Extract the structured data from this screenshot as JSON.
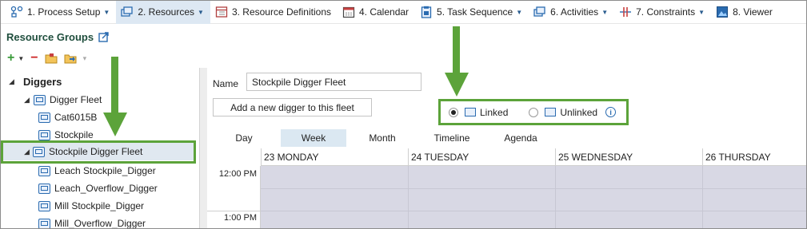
{
  "menu": [
    {
      "label": "1. Process Setup",
      "icon": "process-setup-icon",
      "caret": true
    },
    {
      "label": "2. Resources",
      "icon": "resources-icon",
      "caret": true,
      "active": true
    },
    {
      "label": "3. Resource Definitions",
      "icon": "resource-definitions-icon",
      "caret": false
    },
    {
      "label": "4. Calendar",
      "icon": "calendar-icon",
      "caret": false
    },
    {
      "label": "5. Task Sequence",
      "icon": "task-sequence-icon",
      "caret": true
    },
    {
      "label": "6. Activities",
      "icon": "activities-icon",
      "caret": true
    },
    {
      "label": "7. Constraints",
      "icon": "constraints-icon",
      "caret": true
    },
    {
      "label": "8. Viewer",
      "icon": "viewer-icon",
      "caret": false
    }
  ],
  "resource_groups": {
    "title": "Resource Groups",
    "tree": [
      {
        "label": "Diggers",
        "level": 0,
        "expanded": true
      },
      {
        "label": "Digger Fleet",
        "level": 1,
        "expanded": true
      },
      {
        "label": "Cat6015B",
        "level": 2
      },
      {
        "label": "Stockpile",
        "level": 2
      },
      {
        "label": "Stockpile Digger Fleet",
        "level": 1,
        "expanded": true,
        "selected": true
      },
      {
        "label": "Leach Stockpile_Digger",
        "level": 2
      },
      {
        "label": "Leach_Overflow_Digger",
        "level": 2
      },
      {
        "label": "Mill Stockpile_Digger",
        "level": 2
      },
      {
        "label": "Mill_Overflow_Digger",
        "level": 2
      }
    ]
  },
  "detail": {
    "name_label": "Name",
    "name_value": "Stockpile Digger Fleet",
    "add_button": "Add a new digger to this fleet",
    "linked_label": "Linked",
    "unlinked_label": "Unlinked",
    "selected_option": "Linked"
  },
  "calendar": {
    "views": [
      "Day",
      "Week",
      "Month",
      "Timeline",
      "Agenda"
    ],
    "active_view": "Week",
    "days": [
      "23 MONDAY",
      "24 TUESDAY",
      "25 WEDNESDAY",
      "26 THURSDAY"
    ],
    "times": [
      "12:00 PM",
      "1:00 PM"
    ]
  },
  "colors": {
    "highlight": "#5ca33a",
    "accent": "#2a6bb0",
    "title": "#1f4e3d"
  }
}
